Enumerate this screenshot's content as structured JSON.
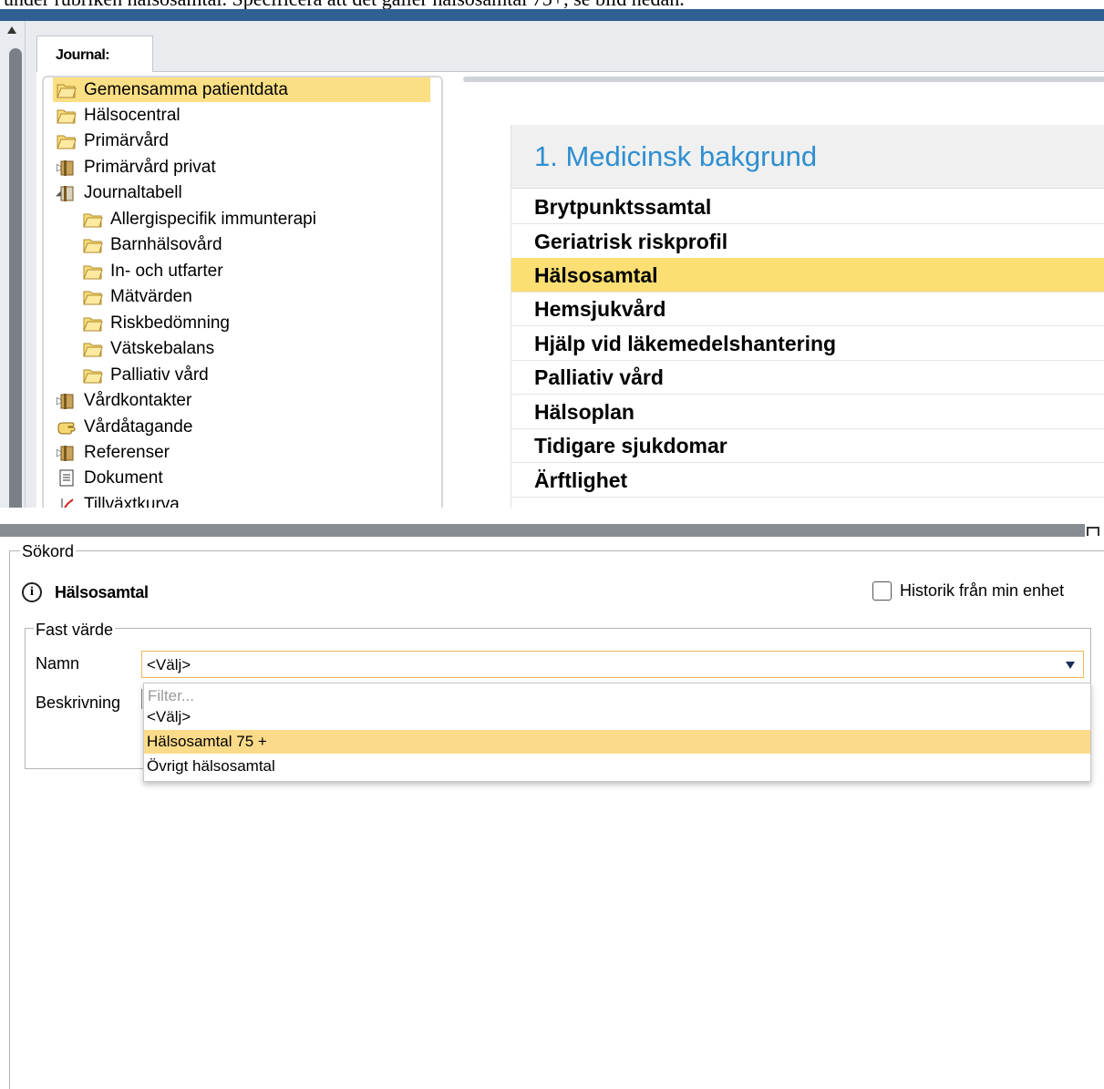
{
  "caption": "under rubriken hälsosamtal. Specificera att det gäller hälsosamtal 75+, se bild nedan.",
  "journal": {
    "tab_label": "Journal:",
    "tree": [
      {
        "label": "Gemensamma patientdata",
        "icon": "folder-open-icon",
        "selected": true
      },
      {
        "label": "Hälsocentral",
        "icon": "folder-open-icon"
      },
      {
        "label": "Primärvård",
        "icon": "folder-open-icon"
      },
      {
        "label": "Primärvård privat",
        "icon": "folder-closed-icon",
        "expander": "collapsed"
      },
      {
        "label": "Journaltabell",
        "icon": "folder-closed-icon",
        "expander": "expanded"
      },
      {
        "label": "Allergispecifik immunterapi",
        "icon": "folder-open-icon"
      },
      {
        "label": "Barnhälsovård",
        "icon": "folder-open-icon"
      },
      {
        "label": "In- och utfarter",
        "icon": "folder-open-icon"
      },
      {
        "label": "Mätvärden",
        "icon": "folder-open-icon"
      },
      {
        "label": "Riskbedömning",
        "icon": "folder-open-icon"
      },
      {
        "label": "Vätskebalans",
        "icon": "folder-open-icon"
      },
      {
        "label": "Palliativ vård",
        "icon": "folder-open-icon"
      },
      {
        "label": "Vårdkontakter",
        "icon": "folder-closed-icon",
        "expander": "collapsed"
      },
      {
        "label": "Vårdåtagande",
        "icon": "hand-icon"
      },
      {
        "label": "Referenser",
        "icon": "folder-closed-icon",
        "expander": "collapsed"
      },
      {
        "label": "Dokument",
        "icon": "document-icon"
      },
      {
        "label": "Tillväxtkurva",
        "icon": "growth-chart-icon"
      }
    ],
    "med": {
      "header": "1. Medicinsk bakgrund",
      "items": [
        "Brytpunktssamtal",
        "Geriatrisk riskprofil",
        "Hälsosamtal",
        "Hemsjukvård",
        "Hjälp vid läkemedelshantering",
        "Palliativ vård",
        "Hälsoplan",
        "Tidigare sjukdomar",
        "Ärftlighet"
      ],
      "selected": "Hälsosamtal"
    }
  },
  "sokord": {
    "legend": "Sökord",
    "title": "Hälsosamtal",
    "history_label": "Historik från min enhet",
    "history_checked": false,
    "fast_varde": {
      "legend": "Fast värde",
      "namn_label": "Namn",
      "namn_value": "<Välj>",
      "beskrivning_label": "Beskrivning"
    },
    "dropdown": {
      "filter_placeholder": "Filter...",
      "options": [
        "<Välj>",
        "Hälsosamtal 75 +",
        "Övrigt hälsosamtal"
      ],
      "highlighted": "Hälsosamtal 75 +"
    }
  },
  "colors": {
    "selection": "#fbdf84",
    "header_blue": "#2e8fd0",
    "top_bar": "#2f5f93",
    "focus_border": "#f0b757"
  }
}
